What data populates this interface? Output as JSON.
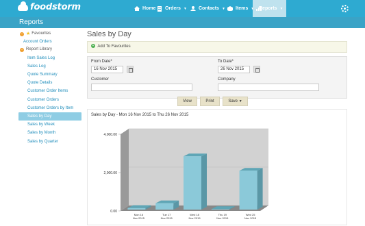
{
  "app": {
    "logo_text": "foodstorm"
  },
  "nav": [
    {
      "label": "Home",
      "icon": "home-icon"
    },
    {
      "label": "Orders",
      "icon": "orders-icon"
    },
    {
      "label": "Contacts",
      "icon": "contacts-icon"
    },
    {
      "label": "Items",
      "icon": "items-icon"
    },
    {
      "label": "Reports",
      "icon": "reports-icon"
    }
  ],
  "page": {
    "section_title": "Reports",
    "title": "Sales by Day",
    "add_favourites": "Add To Favourites"
  },
  "sidebar": {
    "favourites": "Favourites",
    "account_orders": "Account Orders",
    "report_library": "Report Library",
    "items": [
      "Item Sales Log",
      "Sales Log",
      "Quote Summary",
      "Quote Details",
      "Customer Order Items",
      "Customer Orders",
      "Customer Orders by Item",
      "Sales by Day",
      "Sales by Week",
      "Sales by Month",
      "Sales by Quarter"
    ]
  },
  "form": {
    "from_label": "From Date*",
    "from_value": "16 Nov 2015",
    "to_label": "To Date*",
    "to_value": "26 Nov 2015",
    "customer_label": "Customer",
    "customer_value": "",
    "company_label": "Company",
    "company_value": ""
  },
  "buttons": {
    "view": "View",
    "print": "Print",
    "save": "Save"
  },
  "chart_data": {
    "type": "bar",
    "title": "Sales by Day - Mon 16 Nov 2015 to Thu 26 Nov 2015",
    "categories": [
      [
        "Mon 16",
        "Nov 2015"
      ],
      [
        "Tue 17",
        "Nov 2015"
      ],
      [
        "Wed 18",
        "Nov 2015"
      ],
      [
        "Thu 19",
        "Nov 2015"
      ],
      [
        "Wed 25",
        "Nov 2015"
      ]
    ],
    "values": [
      150,
      400,
      2850,
      100,
      2100
    ],
    "yticks": [
      "4,000.00",
      "2,000.00",
      "0.00"
    ],
    "ylim": [
      0,
      4000
    ],
    "colors": {
      "bar_front": "#8bc9d9",
      "bar_top": "#5fa6b6",
      "bar_side": "#5a97a6",
      "wall_back": "#d2d2d2",
      "wall_side": "#9a9a9a",
      "floor": "#888888"
    }
  }
}
